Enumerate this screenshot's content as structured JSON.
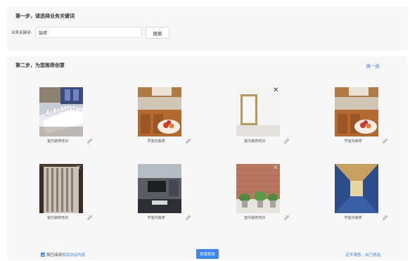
{
  "step1": {
    "title": "第一步，请选择业务关键词",
    "keyword_label": "业务关键词:",
    "keyword_value": "装修",
    "search_label": "搜索"
  },
  "step2": {
    "title": "第二步，为您推荐创意",
    "refresh_label": "换一批",
    "cards": [
      {
        "caption": "室内装修培训",
        "image": "dining-room"
      },
      {
        "caption": "学室内装修",
        "image": "kitchen"
      },
      {
        "caption": "室内装修培训",
        "image": "mirror-frame"
      },
      {
        "caption": "学室内装修",
        "image": "kitchen"
      },
      {
        "caption": "室内装修培训",
        "image": "wooden-door"
      },
      {
        "caption": "学室内装修",
        "image": "living-room-tv"
      },
      {
        "caption": "室内装修培训",
        "image": "brick-wall-plants"
      },
      {
        "caption": "学室内装修",
        "image": "blue-corridor"
      }
    ]
  },
  "footer": {
    "agree_text": "我已阅读",
    "agree_link": "相关协议内容",
    "submit_label": "快速投放",
    "self_select_label": "还不满意，自己挑选"
  },
  "colors": {
    "accent": "#3d84f5",
    "panel": "#f7f7f8"
  }
}
